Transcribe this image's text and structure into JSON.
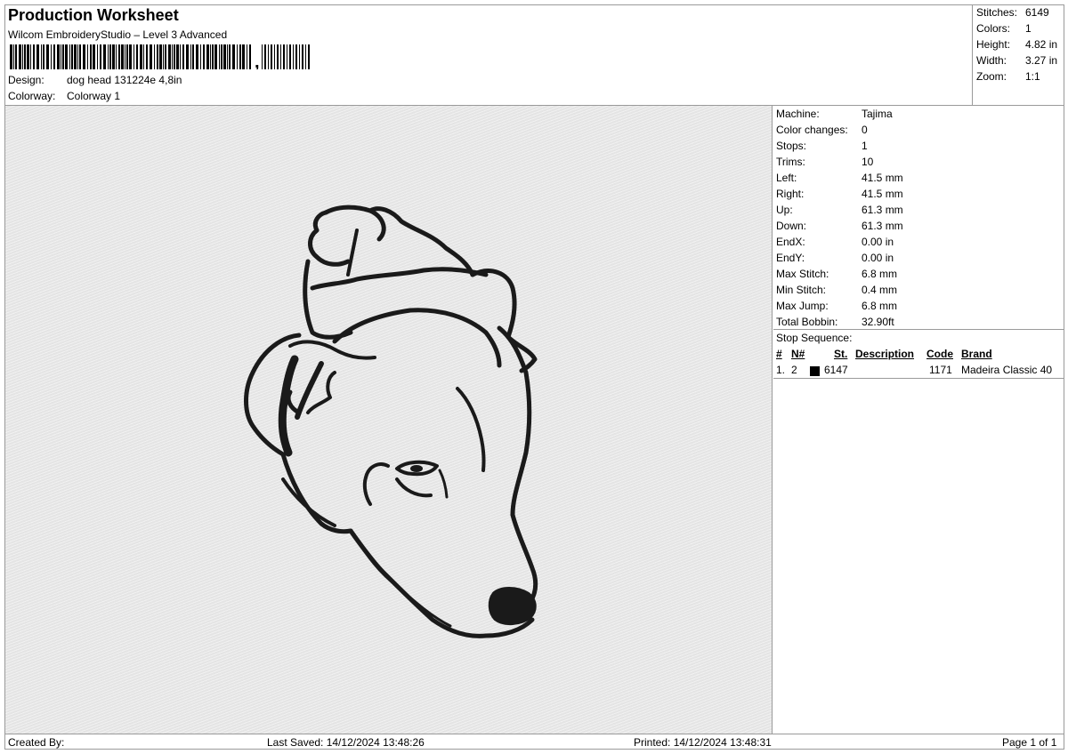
{
  "header": {
    "title": "Production Worksheet",
    "software": "Wilcom EmbroideryStudio – Level 3 Advanced",
    "barcode_suffix": ",",
    "design_label": "Design:",
    "design_value": "dog head 131224e 4,8in",
    "colorway_label": "Colorway:",
    "colorway_value": "Colorway 1"
  },
  "summary": [
    {
      "label": "Stitches:",
      "value": "6149"
    },
    {
      "label": "Colors:",
      "value": "1"
    },
    {
      "label": "Height:",
      "value": "4.82 in"
    },
    {
      "label": "Width:",
      "value": "3.27 in"
    },
    {
      "label": "Zoom:",
      "value": "1:1"
    }
  ],
  "machine_info": [
    {
      "label": "Machine:",
      "value": "Tajima"
    },
    {
      "label": "Color changes:",
      "value": "0"
    },
    {
      "label": "Stops:",
      "value": "1"
    },
    {
      "label": "Trims:",
      "value": "10"
    },
    {
      "label": "Left:",
      "value": "41.5 mm"
    },
    {
      "label": "Right:",
      "value": "41.5 mm"
    },
    {
      "label": "Up:",
      "value": "61.3 mm"
    },
    {
      "label": "Down:",
      "value": "61.3 mm"
    },
    {
      "label": "EndX:",
      "value": "0.00 in"
    },
    {
      "label": "EndY:",
      "value": "0.00 in"
    },
    {
      "label": "Max Stitch:",
      "value": "6.8 mm"
    },
    {
      "label": "Min Stitch:",
      "value": "0.4 mm"
    },
    {
      "label": "Max Jump:",
      "value": "6.8 mm"
    },
    {
      "label": "Total Bobbin:",
      "value": "32.90ft"
    }
  ],
  "stop_sequence": {
    "title": "Stop Sequence:",
    "columns": [
      "#",
      "N#",
      "St.",
      "Description",
      "Code",
      "Brand"
    ],
    "rows": [
      {
        "index": "1.",
        "n": "2",
        "color": "#000000",
        "stitches": "6147",
        "description": "",
        "code": "1171",
        "brand": "Madeira Classic 40"
      }
    ]
  },
  "footer": {
    "created_by": "Created By:",
    "last_saved": "Last Saved: 14/12/2024 13:48:26",
    "printed": "Printed: 14/12/2024 13:48:31",
    "page": "Page 1 of 1"
  },
  "design_preview": {
    "thread_color": "#1a1a1a",
    "background_color": "#e9e9e9",
    "icon": "dog-head-embroidery"
  }
}
